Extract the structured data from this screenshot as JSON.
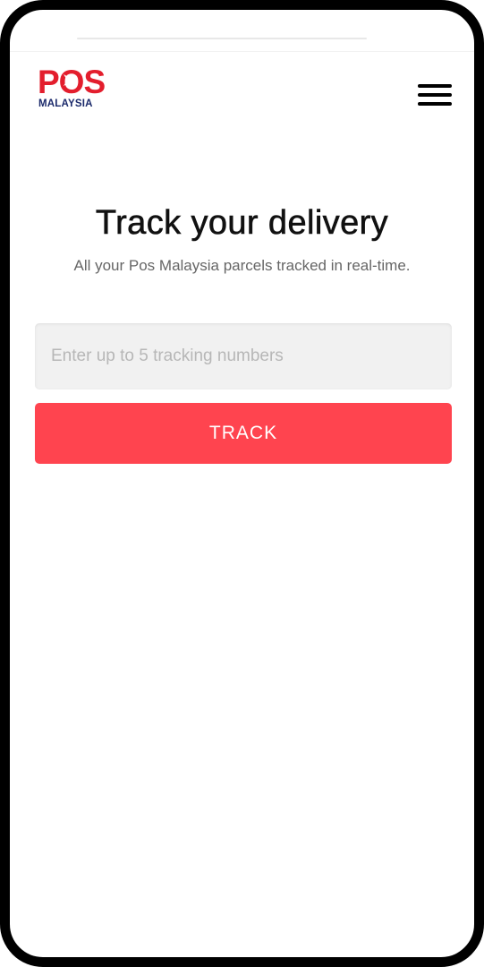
{
  "brand": {
    "logo_text": "POS",
    "logo_subtext": "MALAYSIA",
    "primary_color": "#e31e2d",
    "secondary_color": "#1b2a6b"
  },
  "header": {
    "menu_icon": "hamburger-menu-icon"
  },
  "main": {
    "title": "Track your delivery",
    "subtitle": "All your Pos Malaysia parcels tracked in real-time."
  },
  "tracking": {
    "input_value": "",
    "placeholder": "Enter up to 5 tracking numbers",
    "button_label": "TRACK",
    "button_color": "#ff444f"
  }
}
